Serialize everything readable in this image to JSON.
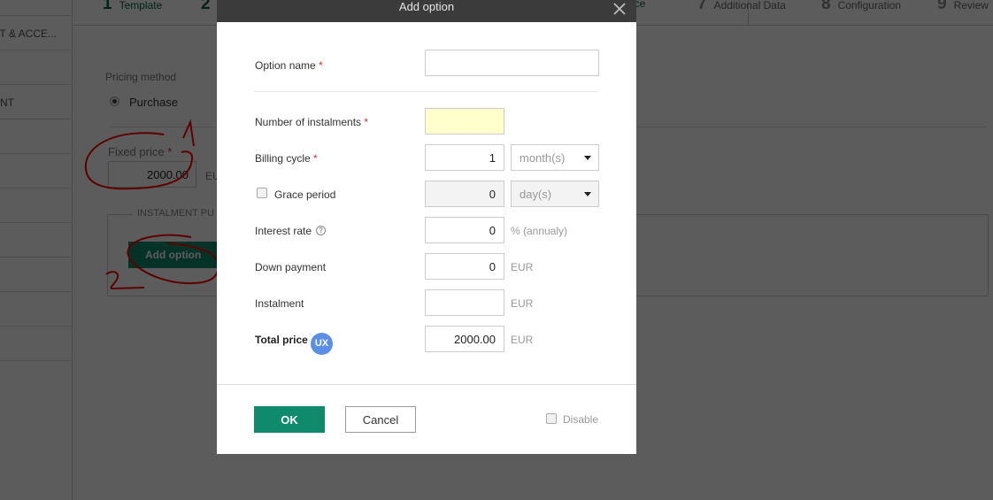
{
  "background": {
    "sidebar": {
      "items": [
        {
          "label": ""
        },
        {
          "label": "T & ACCE..."
        },
        {
          "label": ""
        },
        {
          "label": "NT"
        },
        {
          "label": ""
        },
        {
          "label": ""
        },
        {
          "label": ""
        },
        {
          "label": ""
        },
        {
          "label": ""
        },
        {
          "label": ""
        },
        {
          "label": ""
        }
      ]
    },
    "wizard": {
      "steps": [
        {
          "num": "1",
          "label": "Template"
        },
        {
          "num": "2",
          "label": ""
        },
        {
          "num": "",
          "label": "rice"
        },
        {
          "num": "7",
          "label": "Additional Data"
        },
        {
          "num": "8",
          "label": "Configuration"
        },
        {
          "num": "9",
          "label": "Review"
        }
      ]
    },
    "pricing_method_label": "Pricing method",
    "pricing_method_value": "Purchase",
    "fixed_price_label": "Fixed price",
    "fixed_price_value": "2000.00",
    "fixed_price_unit": "EU",
    "instalment_legend": "INSTALMENT PU",
    "add_option_label": "Add option",
    "annotations": {
      "mark1": "1",
      "mark2": "2",
      "color": "#ff0000"
    }
  },
  "modal": {
    "title": "Add option",
    "close_icon": "close-icon",
    "required_mark": "*",
    "fields": {
      "option_name": {
        "label": "Option name",
        "value": ""
      },
      "number_of_instalments": {
        "label": "Number of instalments",
        "value": ""
      },
      "billing_cycle": {
        "label": "Billing cycle",
        "value": "1",
        "unit": "month(s)"
      },
      "grace_period": {
        "label": "Grace period",
        "checked": false,
        "value": "0",
        "unit": "day(s)"
      },
      "interest_rate": {
        "label": "Interest rate",
        "help_icon": "?",
        "value": "0",
        "unit": "% (annualy)"
      },
      "down_payment": {
        "label": "Down payment",
        "value": "0",
        "unit": "EUR"
      },
      "instalment": {
        "label": "Instalment",
        "value": "",
        "unit": "EUR"
      },
      "total_price": {
        "label": "Total price",
        "badge": "UX",
        "value": "2000.00",
        "unit": "EUR"
      }
    },
    "buttons": {
      "ok": "OK",
      "cancel": "Cancel"
    },
    "disable": {
      "label": "Disable",
      "checked": false
    }
  },
  "colors": {
    "accent": "#0f8a6c",
    "header": "#3b3b3b",
    "required_field": "#ffffcc",
    "badge": "#5b8fe6"
  }
}
